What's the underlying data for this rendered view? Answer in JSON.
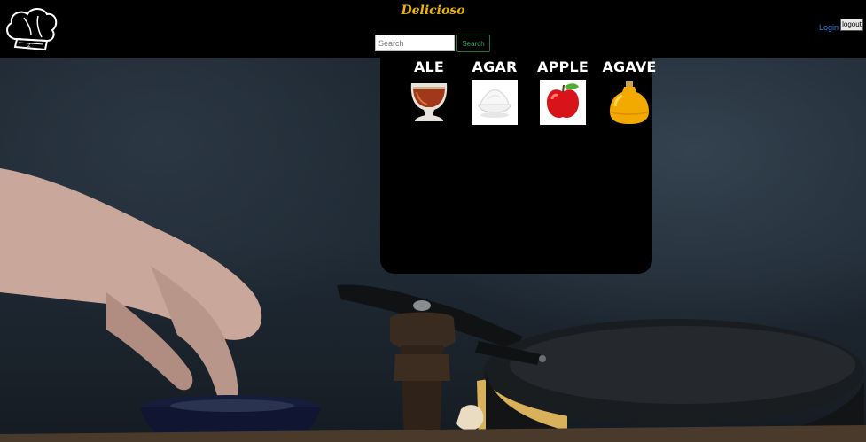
{
  "header": {
    "brand": "Delicioso",
    "search": {
      "placeholder": "Search",
      "value": "",
      "button_label": "Search"
    },
    "login_label": "Login",
    "logout_label": "logout"
  },
  "results": [
    {
      "title": "ALE",
      "icon": "ale-glass-image"
    },
    {
      "title": "AGAR",
      "icon": "agar-powder-bowl-image"
    },
    {
      "title": "APPLE",
      "icon": "red-apple-image"
    },
    {
      "title": "AGAVE",
      "icon": "agave-syrup-jar-image"
    }
  ],
  "colors": {
    "brand": "#f0b400",
    "search_button_text": "#2ea65c",
    "login_link": "#2f7bd3",
    "header_bg": "#000000",
    "panel_bg": "#000000"
  }
}
